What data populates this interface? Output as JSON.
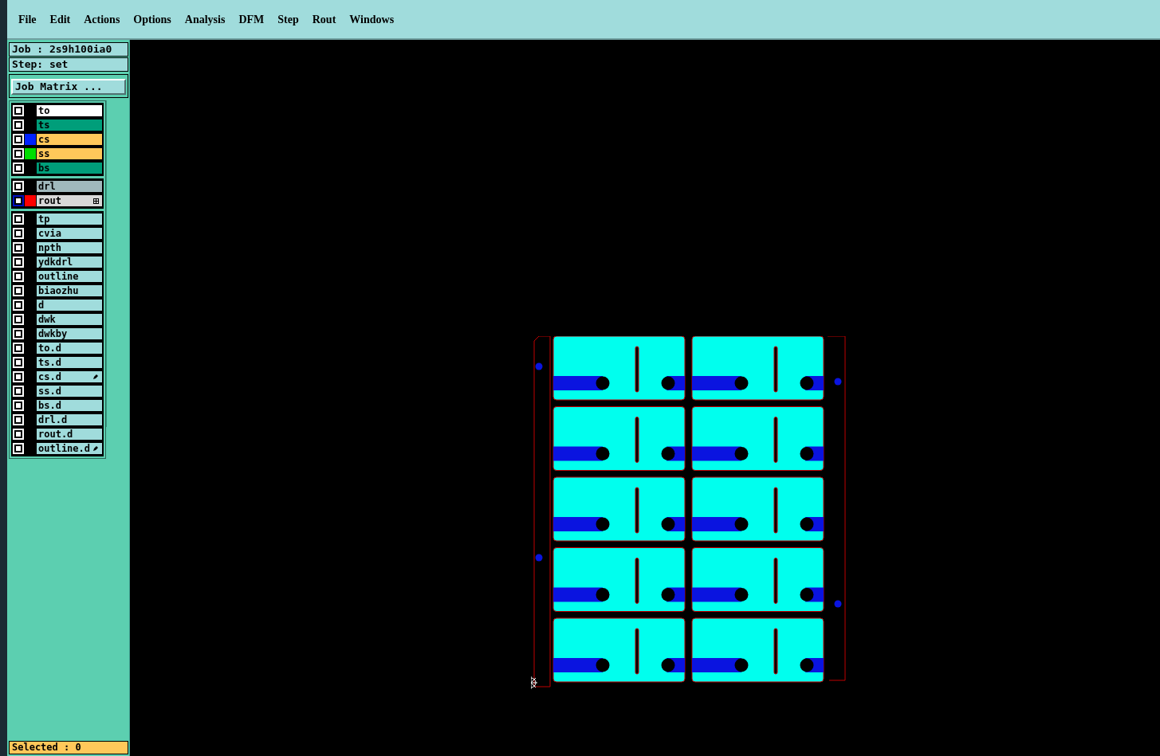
{
  "menu": [
    "File",
    "Edit",
    "Actions",
    "Options",
    "Analysis",
    "DFM",
    "Step",
    "Rout",
    "Windows"
  ],
  "job": "Job : 2s9h100ia0",
  "step": "Step: set",
  "job_matrix_button": "Job Matrix ...",
  "layer_groups": [
    [
      {
        "name": "to",
        "kind": "silk",
        "work_layer": false,
        "expandable": false,
        "edited": false
      },
      {
        "name": "ts",
        "kind": "mask",
        "work_layer": false,
        "expandable": false,
        "edited": false
      },
      {
        "name": "cs",
        "kind": "signal",
        "color": "#0022ff",
        "work_layer": false,
        "expandable": false,
        "edited": false
      },
      {
        "name": "ss",
        "kind": "signal",
        "color": "#00dd00",
        "work_layer": false,
        "expandable": false,
        "edited": false
      },
      {
        "name": "bs",
        "kind": "mask",
        "work_layer": false,
        "expandable": false,
        "edited": false
      }
    ],
    [
      {
        "name": "drl",
        "kind": "drill",
        "work_layer": false,
        "expandable": false,
        "edited": false
      },
      {
        "name": "rout",
        "kind": "rout",
        "color": "#ff0000",
        "work_layer": true,
        "expandable": true,
        "edited": false
      }
    ],
    [
      {
        "name": "tp",
        "kind": "misc",
        "work_layer": false,
        "expandable": false,
        "edited": false
      },
      {
        "name": "cvia",
        "kind": "misc",
        "work_layer": false,
        "expandable": false,
        "edited": false
      },
      {
        "name": "npth",
        "kind": "misc",
        "work_layer": false,
        "expandable": false,
        "edited": false
      },
      {
        "name": "ydkdrl",
        "kind": "misc",
        "work_layer": false,
        "expandable": false,
        "edited": false
      },
      {
        "name": "outline",
        "kind": "misc",
        "work_layer": false,
        "expandable": false,
        "edited": false
      },
      {
        "name": "biaozhu",
        "kind": "misc",
        "work_layer": false,
        "expandable": false,
        "edited": false
      },
      {
        "name": "d",
        "kind": "misc",
        "work_layer": false,
        "expandable": false,
        "edited": false
      },
      {
        "name": "dwk",
        "kind": "misc",
        "work_layer": false,
        "expandable": false,
        "edited": false
      },
      {
        "name": "dwkby",
        "kind": "misc",
        "work_layer": false,
        "expandable": false,
        "edited": false
      },
      {
        "name": "to.d",
        "kind": "misc",
        "work_layer": false,
        "expandable": false,
        "edited": false
      },
      {
        "name": "ts.d",
        "kind": "misc",
        "work_layer": false,
        "expandable": false,
        "edited": false
      },
      {
        "name": "cs.d",
        "kind": "misc",
        "work_layer": false,
        "expandable": false,
        "edited": true
      },
      {
        "name": "ss.d",
        "kind": "misc",
        "work_layer": false,
        "expandable": false,
        "edited": false
      },
      {
        "name": "bs.d",
        "kind": "misc",
        "work_layer": false,
        "expandable": false,
        "edited": false
      },
      {
        "name": "drl.d",
        "kind": "misc",
        "work_layer": false,
        "expandable": false,
        "edited": false
      },
      {
        "name": "rout.d",
        "kind": "misc",
        "work_layer": false,
        "expandable": false,
        "edited": false
      },
      {
        "name": "outline.d",
        "kind": "misc",
        "work_layer": false,
        "expandable": false,
        "edited": true
      }
    ]
  ],
  "status": "Selected : 0"
}
